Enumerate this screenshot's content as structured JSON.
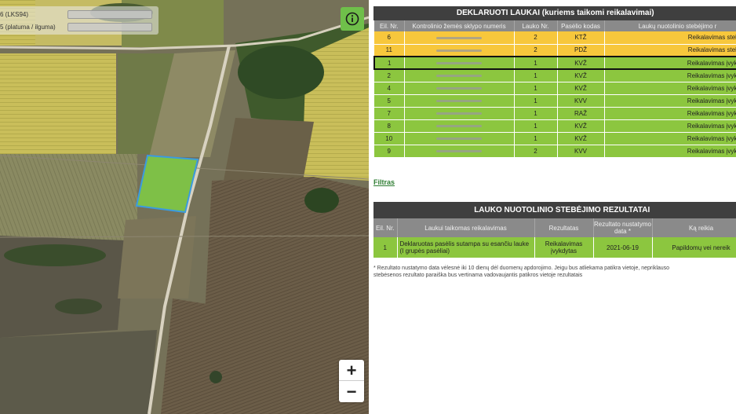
{
  "map": {
    "coord_row1_label": "6 (LKS94)",
    "coord_row2_label": "5 (platuma / ilguma)",
    "zoom_in": "+",
    "zoom_out": "−",
    "icons": [
      "info-icon"
    ],
    "colors": {
      "selected_parcel_fill": "#7ec047",
      "selected_parcel_border": "#3a9be0",
      "info_button": "#6fbf4a"
    }
  },
  "fields_table": {
    "title": "DEKLARUOTI LAUKAI (kuriems taikomi reikalavimai)",
    "columns": [
      "Eil. Nr.",
      "Kontrolinio žemės sklypo numeris",
      "Lauko Nr.",
      "Pasėlio kodas",
      "Laukų nuotolinio stebėjimo r"
    ],
    "rows": [
      {
        "nr": "6",
        "field": "2",
        "crop": "KTŽ",
        "status": "Reikalavimas stebima",
        "tone": "yellow"
      },
      {
        "nr": "11",
        "field": "2",
        "crop": "PDŽ",
        "status": "Reikalavimas stebima",
        "tone": "yellow"
      },
      {
        "nr": "1",
        "field": "1",
        "crop": "KVŽ",
        "status": "Reikalavimas įvykdyta",
        "tone": "green"
      },
      {
        "nr": "2",
        "field": "1",
        "crop": "KVŽ",
        "status": "Reikalavimas įvykdyta",
        "tone": "green"
      },
      {
        "nr": "4",
        "field": "1",
        "crop": "KVŽ",
        "status": "Reikalavimas įvykdyta",
        "tone": "green"
      },
      {
        "nr": "5",
        "field": "1",
        "crop": "KVV",
        "status": "Reikalavimas įvykdyta",
        "tone": "green"
      },
      {
        "nr": "7",
        "field": "1",
        "crop": "RAŽ",
        "status": "Reikalavimas įvykdyta",
        "tone": "green"
      },
      {
        "nr": "8",
        "field": "1",
        "crop": "KVŽ",
        "status": "Reikalavimas įvykdyta",
        "tone": "green"
      },
      {
        "nr": "10",
        "field": "1",
        "crop": "KVŽ",
        "status": "Reikalavimas įvykdyta",
        "tone": "green"
      },
      {
        "nr": "9",
        "field": "2",
        "crop": "KVV",
        "status": "Reikalavimas įvykdyta",
        "tone": "green"
      }
    ],
    "colors": {
      "yellow": "#f7c73c",
      "green": "#8cc63f",
      "header": "#3f3f3f"
    }
  },
  "filter_link": "Filtras",
  "results_table": {
    "title": "LAUKO  NUOTOLINIO STEBĖJIMO REZULTATAI",
    "columns": [
      "Eil. Nr.",
      "Laukui taikomas reikalavimas",
      "Rezultatas",
      "Rezultato nustatymo data *",
      "Ką reikia"
    ],
    "rows": [
      {
        "nr": "1",
        "requirement": "Deklaruotas pasėlis sutampa su esančiu lauke (I grupės pasėliai)",
        "result": "Reikalavimas įvykdytas",
        "date": "2021-06-19",
        "action": "Papildomų vei nereik"
      }
    ]
  },
  "footnote_line1": "* Rezultato nustatymo data vėlesnė iki 10 dienų dėl duomenų apdorojimo. Jeigu bus atliekama patikra vietoje, nepriklauso",
  "footnote_line2": "stebėsenos rezultato paraiška bus vertinama vadovaujantis patikros vietoje rezultatais"
}
